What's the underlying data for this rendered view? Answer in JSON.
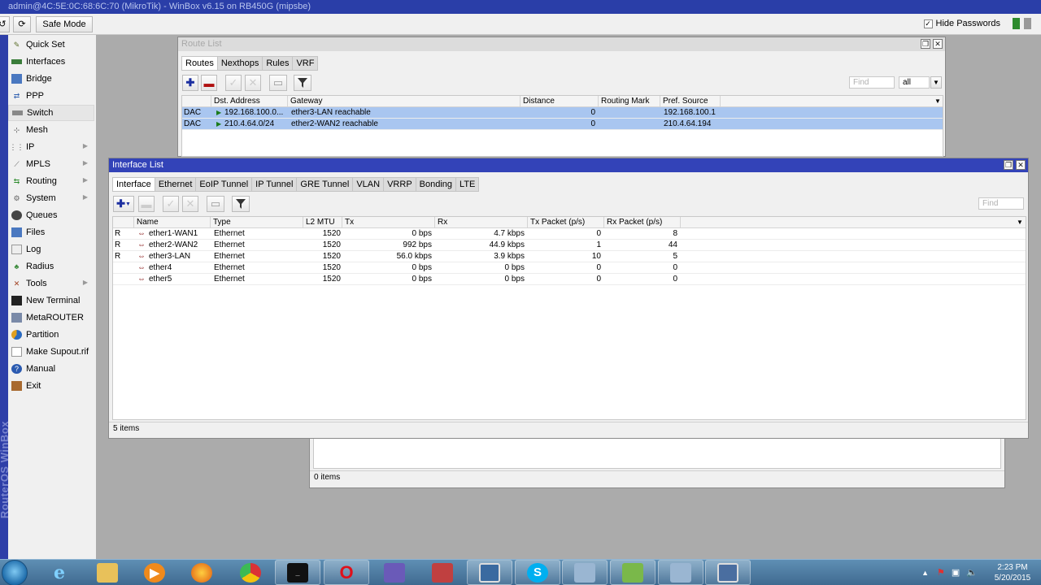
{
  "app": {
    "title": "admin@4C:5E:0C:68:6C:70 (MikroTik) - WinBox v6.15 on RB450G (mipsbe)"
  },
  "toolbar": {
    "safe_mode": "Safe Mode",
    "hide_passwords": "Hide Passwords",
    "undo_icon": "undo-icon",
    "redo_icon": "redo-icon"
  },
  "sidebar": {
    "brand": "RouterOS WinBox",
    "items": [
      {
        "label": "Quick Set",
        "icon": "quick-set-icon"
      },
      {
        "label": "Interfaces",
        "icon": "interfaces-icon"
      },
      {
        "label": "Bridge",
        "icon": "bridge-icon"
      },
      {
        "label": "PPP",
        "icon": "ppp-icon"
      },
      {
        "label": "Switch",
        "icon": "switch-icon"
      },
      {
        "label": "Mesh",
        "icon": "mesh-icon"
      },
      {
        "label": "IP",
        "icon": "ip-icon"
      },
      {
        "label": "MPLS",
        "icon": "mpls-icon"
      },
      {
        "label": "Routing",
        "icon": "routing-icon"
      },
      {
        "label": "System",
        "icon": "system-icon"
      },
      {
        "label": "Queues",
        "icon": "queues-icon"
      },
      {
        "label": "Files",
        "icon": "files-icon"
      },
      {
        "label": "Log",
        "icon": "log-icon"
      },
      {
        "label": "Radius",
        "icon": "radius-icon"
      },
      {
        "label": "Tools",
        "icon": "tools-icon"
      },
      {
        "label": "New Terminal",
        "icon": "terminal-icon"
      },
      {
        "label": "MetaROUTER",
        "icon": "metarouter-icon"
      },
      {
        "label": "Partition",
        "icon": "partition-icon"
      },
      {
        "label": "Make Supout.rif",
        "icon": "supout-icon"
      },
      {
        "label": "Manual",
        "icon": "manual-icon"
      },
      {
        "label": "Exit",
        "icon": "exit-icon"
      }
    ]
  },
  "route_list": {
    "title": "Route List",
    "tabs": [
      "Routes",
      "Nexthops",
      "Rules",
      "VRF"
    ],
    "find_placeholder": "Find",
    "filter_value": "all",
    "columns": [
      "Dst. Address",
      "Gateway",
      "Distance",
      "Routing Mark",
      "Pref. Source"
    ],
    "rows": [
      {
        "flags": "DAC",
        "dst": "192.168.100.0...",
        "gateway": "ether3-LAN reachable",
        "distance": "0",
        "mark": "",
        "pref": "192.168.100.1"
      },
      {
        "flags": "DAC",
        "dst": "210.4.64.0/24",
        "gateway": "ether2-WAN2 reachable",
        "distance": "0",
        "mark": "",
        "pref": "210.4.64.194"
      }
    ]
  },
  "interface_list": {
    "title": "Interface List",
    "tabs": [
      "Interface",
      "Ethernet",
      "EoIP Tunnel",
      "IP Tunnel",
      "GRE Tunnel",
      "VLAN",
      "VRRP",
      "Bonding",
      "LTE"
    ],
    "find_placeholder": "Find",
    "columns": [
      "Name",
      "Type",
      "L2 MTU",
      "Tx",
      "Rx",
      "Tx Packet (p/s)",
      "Rx Packet (p/s)"
    ],
    "rows": [
      {
        "flag": "R",
        "name": "ether1-WAN1",
        "type": "Ethernet",
        "mtu": "1520",
        "tx": "0 bps",
        "rx": "4.7 kbps",
        "txp": "0",
        "rxp": "8"
      },
      {
        "flag": "R",
        "name": "ether2-WAN2",
        "type": "Ethernet",
        "mtu": "1520",
        "tx": "992 bps",
        "rx": "44.9 kbps",
        "txp": "1",
        "rxp": "44"
      },
      {
        "flag": "R",
        "name": "ether3-LAN",
        "type": "Ethernet",
        "mtu": "1520",
        "tx": "56.0 kbps",
        "rx": "3.9 kbps",
        "txp": "10",
        "rxp": "5"
      },
      {
        "flag": "",
        "name": "ether4",
        "type": "Ethernet",
        "mtu": "1520",
        "tx": "0 bps",
        "rx": "0 bps",
        "txp": "0",
        "rxp": "0"
      },
      {
        "flag": "",
        "name": "ether5",
        "type": "Ethernet",
        "mtu": "1520",
        "tx": "0 bps",
        "rx": "0 bps",
        "txp": "0",
        "rxp": "0"
      }
    ],
    "status": "5 items"
  },
  "back_window": {
    "status": "0 items"
  },
  "taskbar": {
    "apps": [
      "internet-explorer",
      "file-explorer",
      "media-player",
      "firefox",
      "chrome",
      "command-prompt",
      "opera",
      "network-app",
      "flowchart-app",
      "remote-desktop",
      "skype",
      "window-app",
      "notepad-app",
      "window-app-2",
      "winbox"
    ],
    "time": "2:23 PM",
    "date": "5/20/2015"
  },
  "colors": {
    "title_active": "#3343b8",
    "selected_row": "#a9c6f0",
    "taskbar": "#4b7aa3"
  }
}
